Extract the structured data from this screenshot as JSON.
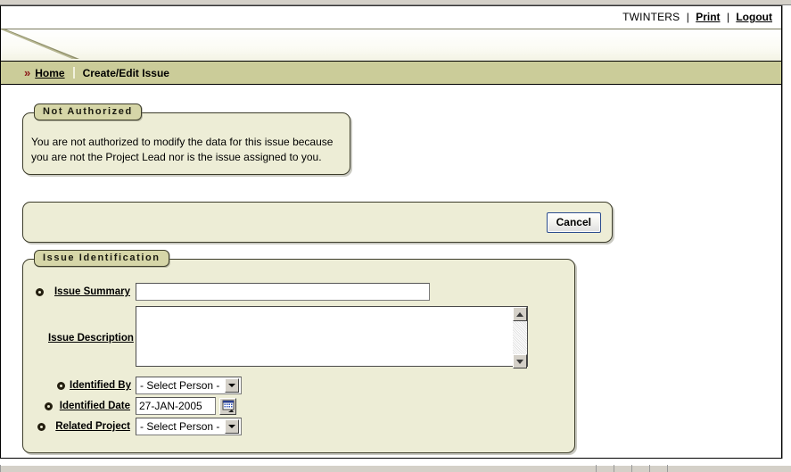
{
  "header": {
    "username": "TWINTERS",
    "sep": "|",
    "print_label": "Print",
    "logout_label": "Logout"
  },
  "breadcrumb": {
    "arrows": "»",
    "home_label": "Home",
    "current_label": "Create/Edit Issue"
  },
  "notice": {
    "legend": "Not Authorized",
    "message": "You are not authorized to modify the data for this issue because you are not the Project Lead nor is the issue assigned to you."
  },
  "actions": {
    "cancel_label": "Cancel"
  },
  "identification": {
    "legend": "Issue Identification",
    "fields": [
      {
        "key": "issue_summary",
        "label": "Issue Summary",
        "type": "text",
        "value": "",
        "placeholder": ""
      },
      {
        "key": "issue_description",
        "label": "Issue Description",
        "type": "textarea",
        "value": "",
        "placeholder": ""
      },
      {
        "key": "identified_by",
        "label": "Identified By",
        "type": "select",
        "value": "- Select Person -",
        "options": [
          "- Select Person -"
        ]
      },
      {
        "key": "identified_date",
        "label": "Identified Date",
        "type": "date",
        "value": "27-JAN-2005",
        "picker_icon": "calendar-icon"
      },
      {
        "key": "related_project",
        "label": "Related Project",
        "type": "select",
        "value": "- Select Person -",
        "options": [
          "- Select Person -"
        ]
      }
    ]
  },
  "colors": {
    "panel_bg": "#EDEDD6",
    "legend_bg": "#D6D6A8",
    "breadcrumb_bg": "#CBCC99",
    "border_dark": "#3C3C2A",
    "link": "#000000",
    "arrow_red": "#8B1A1A",
    "button_border_blue": "#2A4B8D"
  }
}
